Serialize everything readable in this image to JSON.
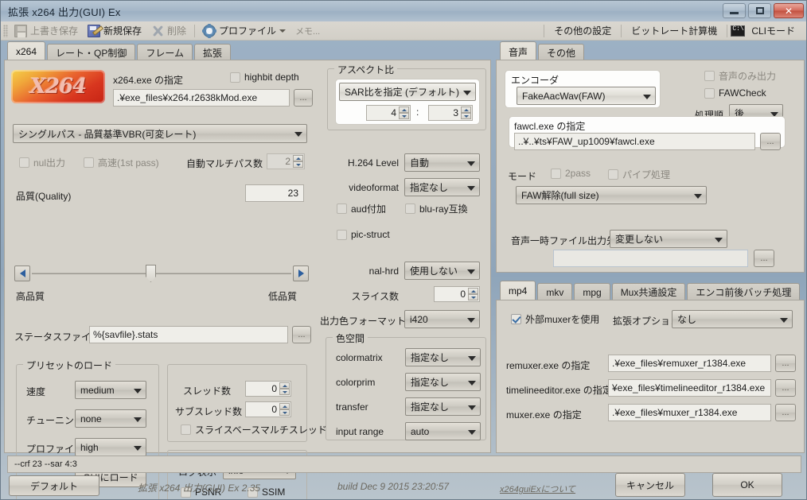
{
  "window": {
    "title": "拡張 x264 出力(GUI) Ex",
    "minimize_label": "minimize",
    "maximize_label": "maximize",
    "close_label": "✕"
  },
  "toolbar": {
    "overwrite_save": "上書き保存",
    "new_save": "新規保存",
    "delete": "削除",
    "profile": "プロファイル",
    "memo": "メモ...",
    "other_settings": "その他の設定",
    "bitrate_calc": "ビットレート計算機",
    "cli_mode": "CLIモード"
  },
  "left_tabs": [
    {
      "label": "x264",
      "active": true
    },
    {
      "label": "レート・QP制御",
      "active": false
    },
    {
      "label": "フレーム",
      "active": false
    },
    {
      "label": "拡張",
      "active": false
    }
  ],
  "right_tabs": [
    {
      "label": "音声",
      "active": true
    },
    {
      "label": "その他",
      "active": false
    }
  ],
  "mux_tabs": [
    {
      "label": "mp4",
      "active": true
    },
    {
      "label": "mkv",
      "active": false
    },
    {
      "label": "mpg",
      "active": false
    },
    {
      "label": "Mux共通設定",
      "active": false
    },
    {
      "label": "エンコ前後バッチ処理",
      "active": false
    }
  ],
  "x264_panel": {
    "logo_text": "X264",
    "exe_label": "x264.exe の指定",
    "highbit_label": "highbit depth",
    "highbit_checked": false,
    "exe_path": ".¥exe_files¥x264.r2638kMod.exe",
    "browse": "...",
    "mode_select": "シングルパス - 品質基準VBR(可変レート)",
    "nul_out": "nul出力",
    "nul_checked": false,
    "fast_1st_pass": "高速(1st pass)",
    "fast_checked": false,
    "auto_multipass_label": "自動マルチパス数",
    "auto_multipass_value": "2",
    "quality_label": "品質(Quality)",
    "quality_value": "23",
    "high_quality": "高品質",
    "low_quality": "低品質",
    "stats_label": "ステータスファイル",
    "stats_value": "%{savfile}.stats"
  },
  "preset": {
    "group_title": "プリセットのロード",
    "speed_label": "速度",
    "speed_value": "medium",
    "tuning_label": "チューニング",
    "tuning_value": "none",
    "profile_label": "プロファイル",
    "profile_value": "high",
    "load_button": "GUIにロード"
  },
  "threads": {
    "threads_label": "スレッド数",
    "threads_value": "0",
    "subthreads_label": "サブスレッド数",
    "subthreads_value": "0",
    "slice_mt_label": "スライスベースマルチスレッド",
    "slice_mt_checked": false
  },
  "log": {
    "log_label": "ログ表示",
    "log_value": "info",
    "psnr_label": "PSNR",
    "psnr_checked": false,
    "ssim_label": "SSIM",
    "ssim_checked": false
  },
  "aspect": {
    "group_title": "アスペクト比",
    "mode": "SAR比を指定 (デフォルト)",
    "ratio_w": "4",
    "ratio_sep": ":",
    "ratio_h": "3"
  },
  "video": {
    "level_label": "H.264 Level",
    "level_value": "自動",
    "videoformat_label": "videoformat",
    "videoformat_value": "指定なし",
    "aud_label": "aud付加",
    "aud_checked": false,
    "bluray_label": "blu-ray互換",
    "bluray_checked": false,
    "picstruct_label": "pic-struct",
    "picstruct_checked": false,
    "nalhrd_label": "nal-hrd",
    "nalhrd_value": "使用しない",
    "slices_label": "スライス数",
    "slices_value": "0",
    "outformat_label": "出力色フォーマット",
    "outformat_value": "i420"
  },
  "colorspace": {
    "group_title": "色空間",
    "colormatrix_label": "colormatrix",
    "colormatrix_value": "指定なし",
    "colorprim_label": "colorprim",
    "colorprim_value": "指定なし",
    "transfer_label": "transfer",
    "transfer_value": "指定なし",
    "inputrange_label": "input range",
    "inputrange_value": "auto"
  },
  "audio": {
    "encoder_label": "エンコーダ",
    "encoder_value": "FakeAacWav(FAW)",
    "audio_only_label": "音声のみ出力",
    "audio_only_checked": false,
    "fawcheck_label": "FAWCheck",
    "fawcheck_checked": false,
    "order_label": "処理順",
    "order_value": "後",
    "exe_label": "fawcl.exe の指定",
    "exe_path": "..¥..¥ts¥FAW_up1009¥fawcl.exe",
    "browse": "...",
    "mode_label": "モード",
    "pass2_label": "2pass",
    "pass2_checked": false,
    "pipe_label": "パイプ処理",
    "pipe_checked": false,
    "mode_value": "FAW解除(full size)",
    "temp_label": "音声一時ファイル出力先",
    "temp_value": "変更しない",
    "temp_path": ""
  },
  "mux": {
    "external_muxer_label": "外部muxerを使用",
    "external_muxer_checked": true,
    "ext_option_label": "拡張オプション",
    "ext_option_value": "なし",
    "remuxer_label": "remuxer.exe の指定",
    "remuxer_value": ".¥exe_files¥remuxer_r1384.exe",
    "timelineeditor_label": "timelineeditor.exe の指定",
    "timelineeditor_value": "¥exe_files¥timelineeditor_r1384.exe",
    "muxer_label": "muxer.exe の指定",
    "muxer_value": ".¥exe_files¥muxer_r1384.exe",
    "browse": "..."
  },
  "footer": {
    "command_line": "--crf 23 --sar 4:3",
    "default_button": "デフォルト",
    "version": "拡張 x264 出力(GUI) Ex 2.35",
    "build": "build Dec  9 2015 23:20:57",
    "about_link": "x264guiExについて",
    "cancel_button": "キャンセル",
    "ok_button": "OK"
  },
  "colors": {
    "accent": "#2d5f9e",
    "panel_bg": "#d5d2ca",
    "titlebar": "#9fb3c6"
  }
}
